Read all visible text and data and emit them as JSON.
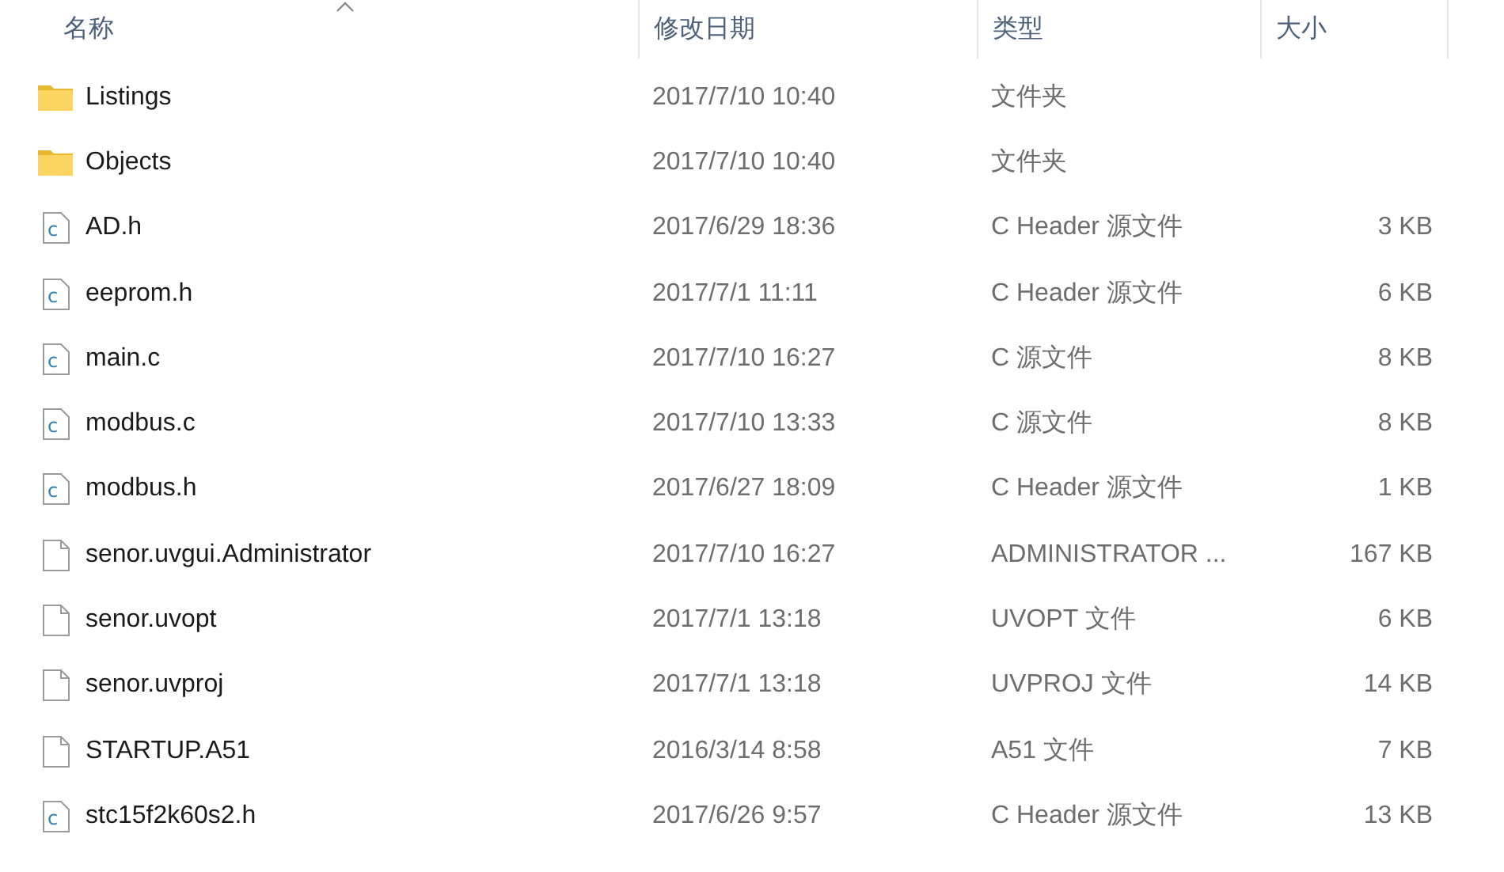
{
  "columns": [
    "名称",
    "修改日期",
    "类型",
    "大小"
  ],
  "rows": [
    {
      "kind": "folder",
      "name": "Listings",
      "date": "2017/7/10 10:40",
      "type": "文件夹"
    },
    {
      "kind": "folder",
      "name": "Objects",
      "date": "2017/7/10 10:40",
      "type": "文件夹"
    },
    {
      "kind": "c",
      "name": "AD.h",
      "date": "2017/6/29 18:36",
      "type": "C Header 源文件",
      "size": "3 KB"
    },
    {
      "kind": "c",
      "name": "eeprom.h",
      "date": "2017/7/1 11:11",
      "type": "C Header 源文件",
      "size": "6 KB"
    },
    {
      "kind": "c",
      "name": "main.c",
      "date": "2017/7/10 16:27",
      "type": "C 源文件",
      "size": "8 KB"
    },
    {
      "kind": "c",
      "name": "modbus.c",
      "date": "2017/7/10 13:33",
      "type": "C 源文件",
      "size": "8 KB"
    },
    {
      "kind": "c",
      "name": "modbus.h",
      "date": "2017/6/27 18:09",
      "type": "C Header 源文件",
      "size": "1 KB"
    },
    {
      "kind": "file",
      "name": "senor.uvgui.Administrator",
      "date": "2017/7/10 16:27",
      "type": "ADMINISTRATOR ...",
      "size": "167 KB"
    },
    {
      "kind": "file",
      "name": "senor.uvopt",
      "date": "2017/7/1 13:18",
      "type": "UVOPT 文件",
      "size": "6 KB"
    },
    {
      "kind": "file",
      "name": "senor.uvproj",
      "date": "2017/7/1 13:18",
      "type": "UVPROJ 文件",
      "size": "14 KB"
    },
    {
      "kind": "file",
      "name": "STARTUP.A51",
      "date": "2016/3/14 8:58",
      "type": "A51 文件",
      "size": "7 KB"
    },
    {
      "kind": "c",
      "name": "stc15f2k60s2.h",
      "date": "2017/6/26 9:57",
      "type": "C Header 源文件",
      "size": "13 KB"
    }
  ]
}
